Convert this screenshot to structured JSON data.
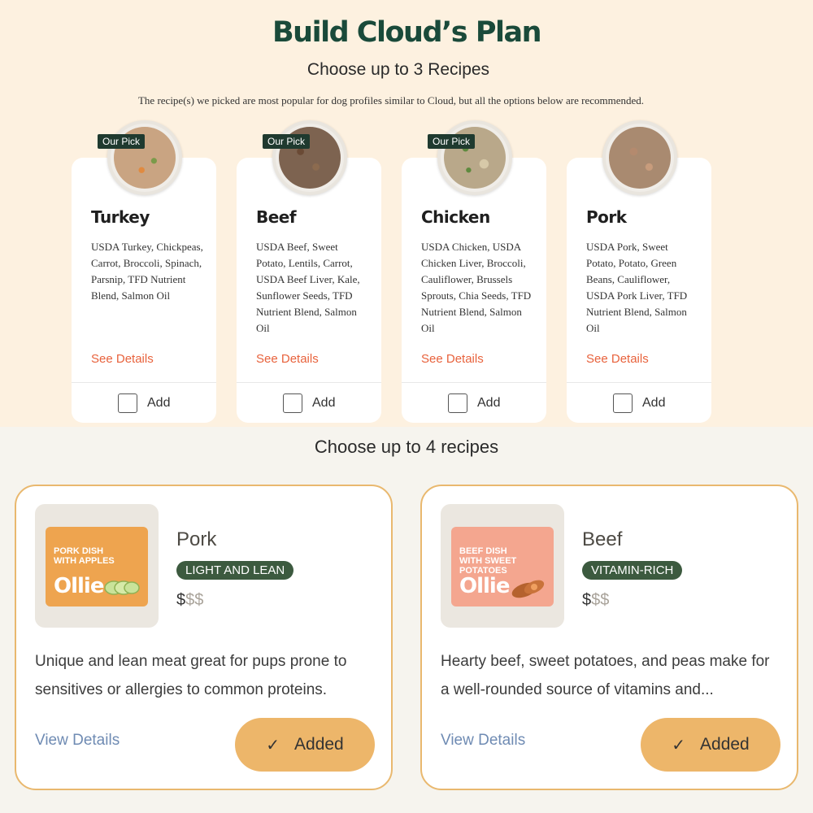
{
  "header": {
    "title": "Build Cloud’s Plan",
    "subtitle": "Choose up to 3 Recipes",
    "note": "The recipe(s) we picked are most popular for dog profiles similar to Cloud, but all the options below are recommended."
  },
  "recipes": [
    {
      "badge": "Our Pick",
      "name": "Turkey",
      "ingredients": "USDA Turkey, Chickpeas, Carrot, Broccoli, Spinach, Parsnip, TFD Nutrient Blend, Salmon Oil",
      "details_label": "See Details",
      "add_label": "Add",
      "checked": false
    },
    {
      "badge": "Our Pick",
      "name": "Beef",
      "ingredients": "USDA Beef, Sweet Potato, Lentils, Carrot, USDA Beef Liver, Kale, Sunflower Seeds, TFD Nutrient Blend, Salmon Oil",
      "details_label": "See Details",
      "add_label": "Add",
      "checked": false
    },
    {
      "badge": "Our Pick",
      "name": "Chicken",
      "ingredients": "USDA Chicken, USDA Chicken Liver, Broccoli, Cauliflower, Brussels Sprouts, Chia Seeds, TFD Nutrient Blend, Salmon Oil",
      "details_label": "See Details",
      "add_label": "Add",
      "checked": false
    },
    {
      "badge": "",
      "name": "Pork",
      "ingredients": "USDA Pork, Sweet Potato, Potato, Green Beans, Cauliflower, USDA Pork Liver, TFD Nutrient Blend, Salmon Oil",
      "details_label": "See Details",
      "add_label": "Add",
      "checked": false
    }
  ],
  "section2": {
    "title": "Choose up to 4 recipes"
  },
  "products": [
    {
      "name": "Pork",
      "package_label": "PORK DISH WITH APPLES",
      "brand": "Ollie",
      "tag": "LIGHT AND LEAN",
      "price_on": "$",
      "price_off": "$$",
      "description": "Unique and lean meat great for pups prone to sensitives or allergies to common proteins.",
      "view_label": "View Details",
      "added_label": "Added",
      "package_color": "#eea44f"
    },
    {
      "name": "Beef",
      "package_label": "BEEF DISH WITH SWEET POTATOES",
      "brand": "Ollie",
      "tag": "VITAMIN-RICH",
      "price_on": "$",
      "price_off": "$$",
      "description": "Hearty beef, sweet potatoes, and peas make for a well-rounded source of vitamins and...",
      "view_label": "View Details",
      "added_label": "Added",
      "package_color": "#f4a68f"
    }
  ],
  "colors": {
    "accent_green": "#1a4a3a",
    "link_orange": "#e8623c",
    "link_blue": "#6f8bb3",
    "added_button": "#edb66a",
    "card_border": "#e9b86e",
    "tag_green": "#3c5a3f"
  }
}
